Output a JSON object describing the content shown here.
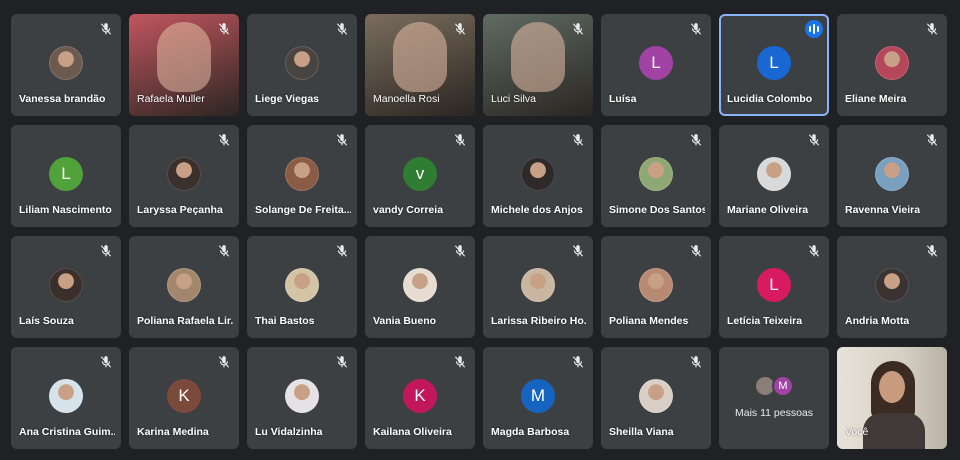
{
  "participants": [
    {
      "name": "Vanessa brandão",
      "type": "photo",
      "color": "#6d5a4f",
      "muted": true
    },
    {
      "name": "Rafaela Muller",
      "type": "video",
      "color": "#c2565f",
      "muted": true
    },
    {
      "name": "Liege Viegas",
      "type": "photo",
      "color": "#4a4440",
      "muted": true
    },
    {
      "name": "Manoella Rosi",
      "type": "video",
      "color": "#7a6d5e",
      "muted": true
    },
    {
      "name": "Luci Silva",
      "type": "video",
      "color": "#5f6b63",
      "muted": true
    },
    {
      "name": "Luísa",
      "type": "initial",
      "initial": "L",
      "color": "#a142a5",
      "muted": true
    },
    {
      "name": "Lucidia Colombo",
      "type": "initial",
      "initial": "L",
      "color": "#1967d2",
      "muted": false,
      "speaking": true,
      "active": true
    },
    {
      "name": "Eliane Meira",
      "type": "photo",
      "color": "#b6465a",
      "muted": true
    },
    {
      "name": "Liliam Nascimento",
      "type": "initial",
      "initial": "L",
      "color": "#51a23a",
      "muted": false
    },
    {
      "name": "Laryssa Peçanha",
      "type": "photo",
      "color": "#3a302c",
      "muted": true
    },
    {
      "name": "Solange De Freita...",
      "type": "photo",
      "color": "#8a5b45",
      "muted": true
    },
    {
      "name": "vandy Correia",
      "type": "initial",
      "initial": "v",
      "color": "#2f7d32",
      "muted": true
    },
    {
      "name": "Michele dos Anjos",
      "type": "photo",
      "color": "#2e2a2a",
      "muted": true
    },
    {
      "name": "Simone Dos Santos",
      "type": "photo",
      "color": "#8fa873",
      "muted": true
    },
    {
      "name": "Mariane Oliveira",
      "type": "photo",
      "color": "#d9d9d9",
      "muted": true
    },
    {
      "name": "Ravenna Vieira",
      "type": "photo",
      "color": "#7aa0bf",
      "muted": true
    },
    {
      "name": "Laís Souza",
      "type": "photo",
      "color": "#3a2f2a",
      "muted": true
    },
    {
      "name": "Poliana Rafaela Lir...",
      "type": "photo",
      "color": "#a3876d",
      "muted": true
    },
    {
      "name": "Thai Bastos",
      "type": "photo",
      "color": "#d3c4a6",
      "muted": true
    },
    {
      "name": "Vania Bueno",
      "type": "photo",
      "color": "#e7dcd2",
      "muted": true
    },
    {
      "name": "Larissa Ribeiro Ho...",
      "type": "photo",
      "color": "#c9b6a0",
      "muted": true
    },
    {
      "name": "Poliana Mendes",
      "type": "photo",
      "color": "#b88a72",
      "muted": true
    },
    {
      "name": "Letícia Teixeira",
      "type": "initial",
      "initial": "L",
      "color": "#d81b60",
      "muted": true
    },
    {
      "name": "Andria Motta",
      "type": "photo",
      "color": "#3b3331",
      "muted": true
    },
    {
      "name": "Ana Cristina Guim...",
      "type": "photo",
      "color": "#d6e3ea",
      "muted": true
    },
    {
      "name": "Karina Medina",
      "type": "initial",
      "initial": "K",
      "color": "#7b4a3a",
      "muted": true
    },
    {
      "name": "Lu Vidalzinha",
      "type": "photo",
      "color": "#e5e1e4",
      "muted": true
    },
    {
      "name": "Kailana Oliveira",
      "type": "initial",
      "initial": "K",
      "color": "#c2185b",
      "muted": true
    },
    {
      "name": "Magda Barbosa",
      "type": "initial",
      "initial": "M",
      "color": "#1565c0",
      "muted": true
    },
    {
      "name": "Sheilla Viana",
      "type": "photo",
      "color": "#d9cfc6",
      "muted": true
    }
  ],
  "more": {
    "label": "Mais 11 pessoas",
    "avatar1_color": "#8a7f78",
    "avatar2_initial": "M",
    "avatar2_color": "#a142a5"
  },
  "self": {
    "name": "Você"
  }
}
